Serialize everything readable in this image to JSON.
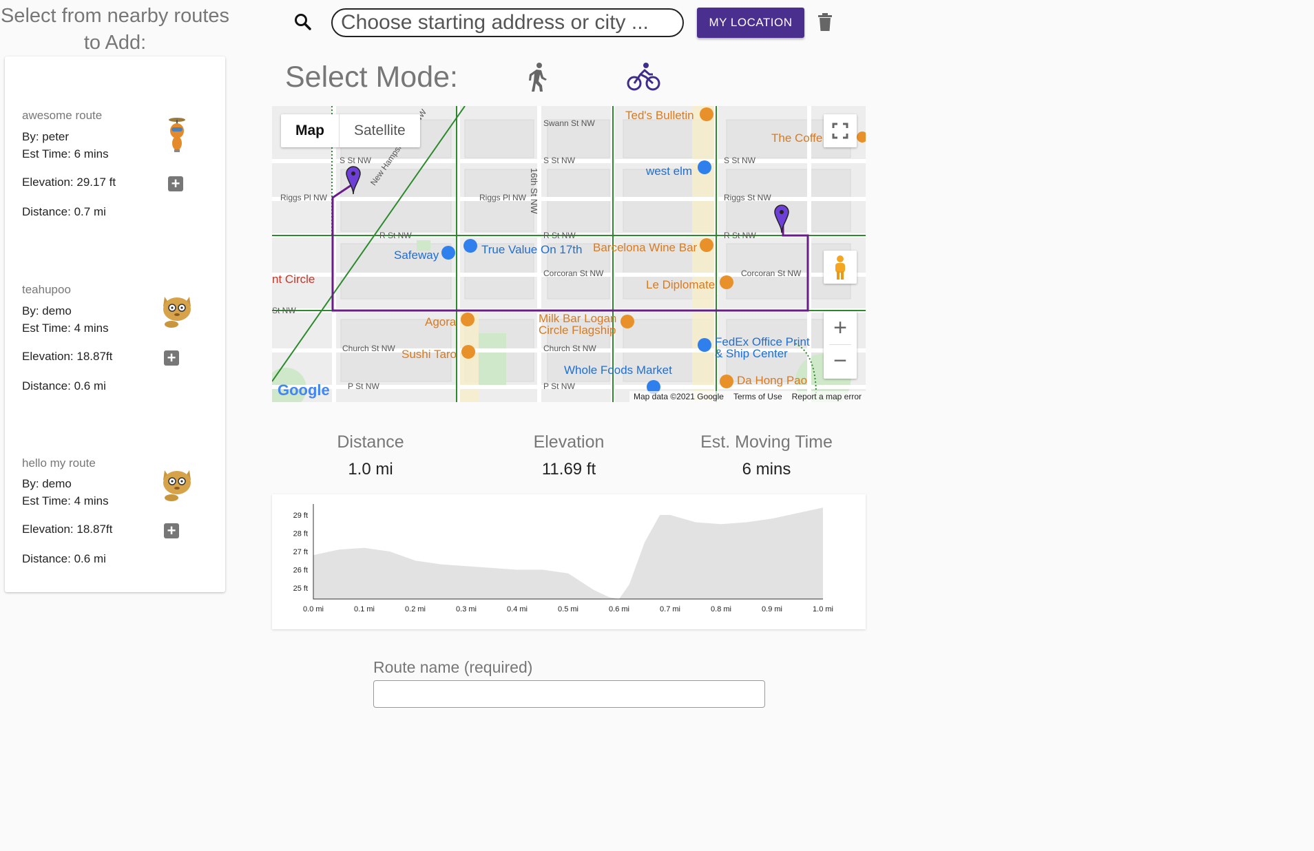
{
  "sidebar": {
    "title": "Select from nearby routes to Add:",
    "routes": [
      {
        "name": "awesome route",
        "by": "By: peter",
        "est_time": "Est Time: 6 mins",
        "elevation": "Elevation: 29.17 ft",
        "distance": "Distance: 0.7 mi",
        "avatar": "robot-avatar-icon"
      },
      {
        "name": "teahupoo",
        "by": "By: demo",
        "est_time": "Est Time: 4 mins",
        "elevation": "Elevation: 18.87ft",
        "distance": "Distance: 0.6 mi",
        "avatar": "cat-avatar-icon"
      },
      {
        "name": "hello my route",
        "by": "By: demo",
        "est_time": "Est Time: 4 mins",
        "elevation": "Elevation: 18.87ft",
        "distance": "Distance: 0.6 mi",
        "avatar": "cat-avatar-icon"
      }
    ],
    "add_symbol": "+"
  },
  "search": {
    "placeholder": "Choose starting address or city ...",
    "my_location_label": "MY LOCATION"
  },
  "mode": {
    "label": "Select Mode:",
    "options": [
      "walk-icon",
      "bike-icon"
    ],
    "selected": "bike"
  },
  "map": {
    "type_tabs": [
      "Map",
      "Satellite"
    ],
    "active_tab": "Map",
    "streets": [
      "Swann St NW",
      "S St NW",
      "S St NW",
      "S St NW",
      "Riggs Pl NW",
      "Riggs Pl NW",
      "Riggs St NW",
      "R St NW",
      "R St NW",
      "R St NW",
      "Corcoran St NW",
      "Corcoran St NW",
      "St NW",
      "Church St NW",
      "Church St NW",
      "P St NW",
      "P St NW",
      "New Hampshire Ave NW",
      "16th St NW",
      "nt Circle"
    ],
    "pois_orange": [
      "Ted's Bulletin",
      "The Coffe",
      "Barcelona Wine Bar",
      "Le Diplomate",
      "Agora",
      "Milk Bar Logan Circle Flagship",
      "Sushi Taro",
      "Da Hong Pao"
    ],
    "pois_blue": [
      "west elm",
      "Safeway",
      "True Value On 17th",
      "FedEx Office Print & Ship Center",
      "Whole Foods Market"
    ],
    "footer": {
      "attribution": "Map data ©2021 Google",
      "terms": "Terms of Use",
      "report": "Report a map error"
    },
    "logo": "Google",
    "route_color": "#6a1b8a",
    "zoom_in": "+",
    "zoom_out": "−"
  },
  "stats": [
    {
      "label": "Distance",
      "value": "1.0 mi"
    },
    {
      "label": "Elevation",
      "value": "11.69 ft"
    },
    {
      "label": "Est. Moving Time",
      "value": "6 mins"
    }
  ],
  "chart_data": {
    "type": "area",
    "x": [
      0,
      0.05,
      0.1,
      0.15,
      0.2,
      0.25,
      0.3,
      0.35,
      0.4,
      0.45,
      0.5,
      0.55,
      0.58,
      0.6,
      0.62,
      0.65,
      0.68,
      0.7,
      0.75,
      0.8,
      0.85,
      0.9,
      0.95,
      1.0
    ],
    "y": [
      26.8,
      27.1,
      27.2,
      27.0,
      26.5,
      26.3,
      26.2,
      26.1,
      26.0,
      26.0,
      25.8,
      24.9,
      24.5,
      24.4,
      25.2,
      27.5,
      29.0,
      29.0,
      28.6,
      28.5,
      28.6,
      28.8,
      29.1,
      29.4
    ],
    "yticks": [
      "29 ft",
      "28 ft",
      "27 ft",
      "26 ft",
      "25 ft"
    ],
    "ytick_values": [
      29,
      28,
      27,
      26,
      25
    ],
    "xticks": [
      "0.0 mi",
      "0.1 mi",
      "0.2 mi",
      "0.3 mi",
      "0.4 mi",
      "0.5 mi",
      "0.6 mi",
      "0.7 mi",
      "0.8 mi",
      "0.9 mi",
      "1.0 mi"
    ],
    "xlim": [
      0,
      1.0
    ],
    "ylim": [
      24.4,
      29.6
    ],
    "fill_color": "#e2e2e2",
    "grid": false
  },
  "form": {
    "route_name_label": "Route name (required)"
  }
}
